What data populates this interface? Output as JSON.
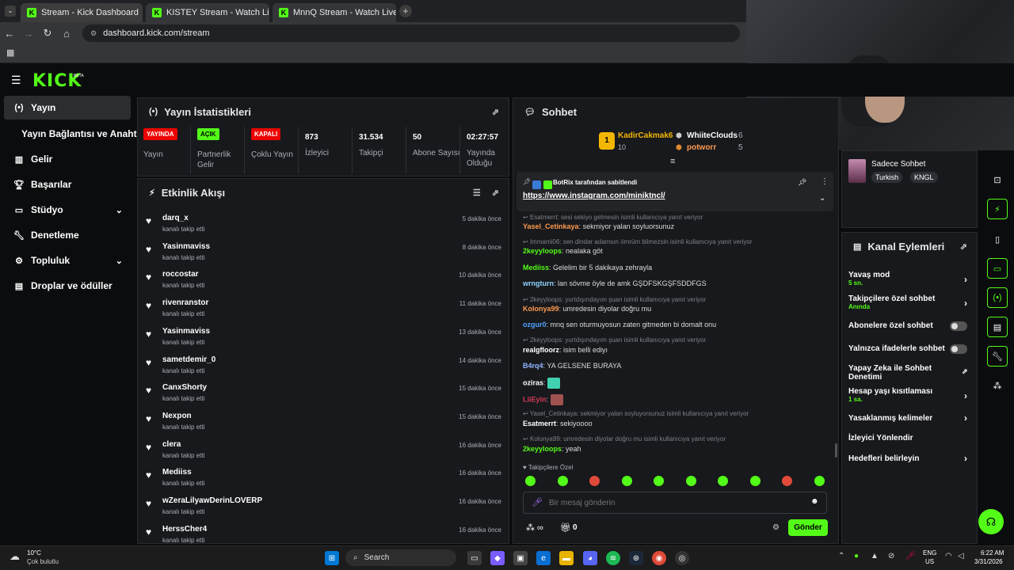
{
  "browser": {
    "tabs": [
      {
        "title": "Stream - Kick Dashboard"
      },
      {
        "title": "KISTEY Stream - Watch Live on"
      },
      {
        "title": "MnnQ Stream - Watch Live on"
      }
    ],
    "url": "dashboard.kick.com/stream"
  },
  "header": {
    "logo": "KICK",
    "beta": "BETA"
  },
  "sidebar": {
    "items": [
      {
        "label": "Yayın"
      },
      {
        "label": "Yayın Bağlantısı ve Anahtarı"
      },
      {
        "label": "Gelir"
      },
      {
        "label": "Başarılar"
      },
      {
        "label": "Stüdyo"
      },
      {
        "label": "Denetleme"
      },
      {
        "label": "Topluluk"
      },
      {
        "label": "Droplar ve ödüller"
      }
    ]
  },
  "stats": {
    "title": "Yayın İstatistikleri",
    "items": [
      {
        "badge": "YAYINDA",
        "label": "Yayın",
        "color": "#eb0400"
      },
      {
        "badge": "AÇIK",
        "label": "Partnerlik Gelir",
        "color": "#53fc18"
      },
      {
        "badge": "KAPALI",
        "label": "Çoklu Yayın",
        "color": "#eb0400"
      },
      {
        "value": "873",
        "label": "İzleyici"
      },
      {
        "value": "31.534",
        "label": "Takipçi"
      },
      {
        "value": "50",
        "label": "Abone Sayısı"
      },
      {
        "value": "02:27:57",
        "label": "Yayında Olduğu"
      }
    ]
  },
  "events": {
    "title": "Etkinlik Akışı",
    "items": [
      {
        "name": "darq_x",
        "sub": "kanalı takip etti",
        "time": "5 dakika önce"
      },
      {
        "name": "Yasinmaviss",
        "sub": "kanalı takip etti",
        "time": "8 dakika önce"
      },
      {
        "name": "roccostar",
        "sub": "kanalı takip etti",
        "time": "10 dakika önce"
      },
      {
        "name": "rivenranstor",
        "sub": "kanalı takip etti",
        "time": "11 dakika önce"
      },
      {
        "name": "Yasinmaviss",
        "sub": "kanalı takip etti",
        "time": "13 dakika önce"
      },
      {
        "name": "sametdemir_0",
        "sub": "kanalı takip etti",
        "time": "14 dakika önce"
      },
      {
        "name": "CanxShorty",
        "sub": "kanalı takip etti",
        "time": "15 dakika önce"
      },
      {
        "name": "Nexpon",
        "sub": "kanalı takip etti",
        "time": "15 dakika önce"
      },
      {
        "name": "clera",
        "sub": "kanalı takip etti",
        "time": "16 dakika önce"
      },
      {
        "name": "Mediiss",
        "sub": "kanalı takip etti",
        "time": "16 dakika önce"
      },
      {
        "name": "wZeraLilyawDerinLOVERP",
        "sub": "kanalı takip etti",
        "time": "16 dakika önce"
      },
      {
        "name": "HerssCher4",
        "sub": "kanalı takip etti",
        "time": "16 dakika önce"
      }
    ]
  },
  "chat": {
    "title": "Sohbet",
    "top": {
      "user1": "KadirCakmak6",
      "user1_rank": "1",
      "user1_count": "10",
      "user2": "WhiiteClouds",
      "user2_count": "6",
      "user3": "potworr",
      "user3_count": "5"
    },
    "pinned": {
      "by": "BotRix tarafından sabitlendi",
      "link": "https://www.instagram.com/miniktncl/"
    },
    "messages": [
      {
        "type": "reply",
        "text": "Esatmerrt: sesi sekiyo gelmesin isimli kullanıcıya yanıt veriyor"
      },
      {
        "type": "msg",
        "user": "Yasel_Cetinkaya",
        "color": "#ff9a4d",
        "text": "sekmiyor yalan soyluorsunuz"
      },
      {
        "type": "reply",
        "text": "Immami06: sen dindar adamsın ömrüm bilmezsin isimli kullanıcıya yanıt veriyor"
      },
      {
        "type": "msg",
        "user": "2keyyloops",
        "color": "#53fc18",
        "text": "nealaka göt"
      },
      {
        "type": "msg",
        "user": "Mediiss",
        "color": "#53fc18",
        "text": "Gelelim bir 5 dakikaya zehrayla"
      },
      {
        "type": "msg",
        "user": "wrngturn",
        "color": "#8fd3ff",
        "text": "lan sövme öyle de amk GŞDFSKGŞFSDDFGS"
      },
      {
        "type": "reply",
        "text": "2keyyloops: yurtdışındayım şuan isimli kullanıcıya yanıt veriyor"
      },
      {
        "type": "msg",
        "user": "Kolonya99",
        "color": "#ff9a4d",
        "text": "umredesin diyolar doğru mu"
      },
      {
        "type": "msg",
        "user": "ozgur0",
        "color": "#4fa3ff",
        "text": "mnq sen oturmuyosun zaten gitmeden bi domalt onu"
      },
      {
        "type": "reply",
        "text": "2keyyloops: yurtdışındayım şuan isimli kullanıcıya yanıt veriyor"
      },
      {
        "type": "msg",
        "user": "realgfloorz",
        "color": "#ffffff",
        "text": "isim belli ediyı"
      },
      {
        "type": "msg",
        "user": "B4rq4",
        "color": "#8fb8ff",
        "text": "YA GELSENE BURAYA"
      },
      {
        "type": "msg",
        "user": "oziras",
        "color": "#ffffff",
        "text": ""
      },
      {
        "type": "msg",
        "user": "LiiEyin",
        "color": "#d43a5a",
        "text": ""
      },
      {
        "type": "reply",
        "text": "Yasel_Cetinkaya: sekmiyor yalan soyluyorsunuz isimli kullanıcıya yanıt veriyor"
      },
      {
        "type": "msg",
        "user": "Esatmerrt",
        "color": "#ffffff",
        "text": "sekiyoooo"
      },
      {
        "type": "reply",
        "text": "Kolonya99: umredesin diyolar doğru mu isimli kullanıcıya yanıt veriyor"
      },
      {
        "type": "msg",
        "user": "2keyyloops",
        "color": "#53fc18",
        "text": "yeah"
      }
    ],
    "followers_only": "Takipçilere Özel",
    "input_placeholder": "Bir mesaj gönderin",
    "points": "0",
    "send": "Gönder"
  },
  "right": {
    "chat_mode_title": "Sadece Sohbet",
    "tags": [
      "Turkish",
      "KNGL"
    ],
    "actions_title": "Kanal Eylemleri",
    "actions": [
      {
        "label": "Yavaş mod",
        "sub": "5 sn."
      },
      {
        "label": "Takipçilere özel sohbet",
        "sub": "Anında"
      },
      {
        "label": "Abonelere özel sohbet",
        "sub": ""
      },
      {
        "label": "Yalnızca ifadelerle sohbet",
        "sub": ""
      },
      {
        "label": "Yapay Zeka ile Sohbet Denetimi",
        "sub": ""
      },
      {
        "label": "Hesap yaşı kısıtlaması",
        "sub": "1 sa."
      },
      {
        "label": "Yasaklanmış kelimeler",
        "sub": ""
      },
      {
        "label": "İzleyici Yönlendir",
        "sub": ""
      },
      {
        "label": "Hedefleri belirleyin",
        "sub": ""
      }
    ]
  },
  "taskbar": {
    "weather_temp": "10°C",
    "weather_desc": "Çok bulutlu",
    "search": "Search",
    "lang1": "ENG",
    "lang2": "US",
    "time": "6:22 AM",
    "date": "3/31/2026"
  }
}
